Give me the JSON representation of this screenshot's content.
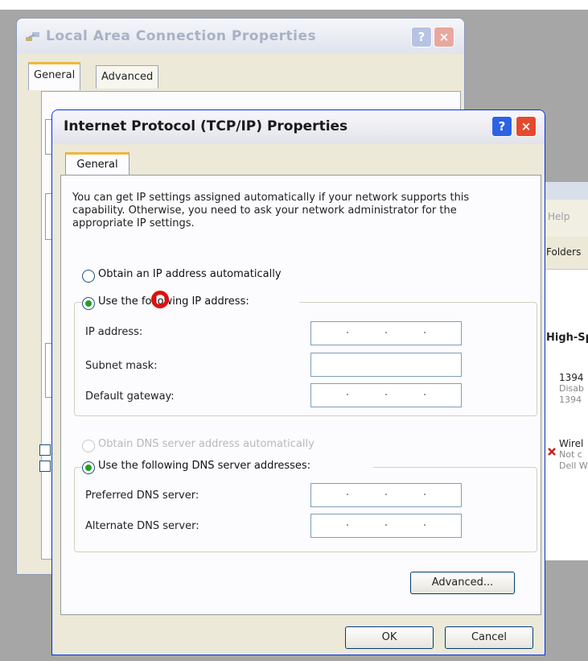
{
  "back_window": {
    "title": "Local Area Connection  Properties",
    "help_label": "?",
    "close_label": "×",
    "tabs": [
      "General",
      "Advanced"
    ]
  },
  "side_window": {
    "menu_item": "Help",
    "toolbar_item": "Folders",
    "section_heading": "High-Sp",
    "item1_name": "1394",
    "item1_status": "Disab",
    "item1_sub": "1394",
    "item2_name": "Wirel",
    "item2_status": "Not c",
    "item2_sub": "Dell W"
  },
  "dialog": {
    "title": "Internet Protocol (TCP/IP) Properties",
    "help_label": "?",
    "close_label": "×",
    "tab": "General",
    "description": "You can get IP settings assigned automatically if your network supports this capability. Otherwise, you need to ask your network administrator for the appropriate IP settings.",
    "ip_auto_label": "Obtain an IP address automatically",
    "ip_manual_label": "Use the following IP address:",
    "ip_fields": [
      {
        "label": "IP address:",
        "value": ".   .   ."
      },
      {
        "label": "Subnet mask:",
        "value": ""
      },
      {
        "label": "Default gateway:",
        "value": ".   .   ."
      }
    ],
    "dns_auto_label": "Obtain DNS server address automatically",
    "dns_manual_label": "Use the following DNS server addresses:",
    "dns_fields": [
      {
        "label": "Preferred DNS server:",
        "value": ".   .   ."
      },
      {
        "label": "Alternate DNS server:",
        "value": ".   .   ."
      }
    ],
    "advanced_button": "Advanced...",
    "ok_button": "OK",
    "cancel_button": "Cancel"
  },
  "colors": {
    "title_active_text": "#1a1a1a",
    "close_button": "#e34a2e",
    "help_button": "#2b63e5",
    "radio_selected": "#21a121",
    "tab_highlight": "#f0b640"
  }
}
